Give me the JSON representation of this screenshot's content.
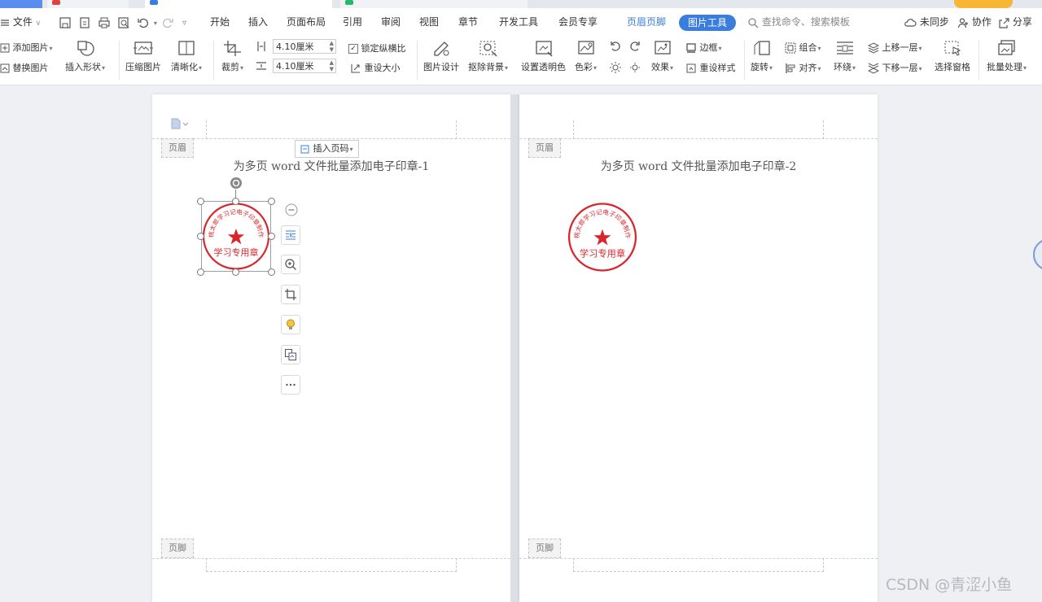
{
  "window": {
    "doc_tabs": [
      "",
      "",
      "",
      ""
    ]
  },
  "menubar": {
    "file_label": "文件",
    "tabs": [
      "开始",
      "插入",
      "页面布局",
      "引用",
      "审阅",
      "视图",
      "章节",
      "开发工具",
      "会员专享",
      "页眉页脚",
      "图片工具"
    ],
    "active_tab": "图片工具",
    "search_placeholder": "查找命令、搜索模板",
    "sync_label": "未同步",
    "collab_label": "协作",
    "share_label": "分享"
  },
  "ribbon": {
    "add_picture": "添加图片",
    "replace_picture": "替换图片",
    "insert_shape": "插入形状",
    "compress_picture": "压缩图片",
    "sharpen": "清晰化",
    "crop": "裁剪",
    "width_value": "4.10厘米",
    "height_value": "4.10厘米",
    "lock_ratio": "锁定纵横比",
    "reset_size": "重设大小",
    "picture_design": "图片设计",
    "remove_background": "抠除背景",
    "set_transparent": "设置透明色",
    "color": "色彩",
    "effects": "效果",
    "border": "边框",
    "reset_style": "重设样式",
    "rotate": "旋转",
    "group": "组合",
    "align": "对齐",
    "wrap": "环绕",
    "bring_forward": "上移一层",
    "send_backward": "下移一层",
    "selection_pane": "选择窗格",
    "batch_process": "批量处理"
  },
  "pages": [
    {
      "header_tag": "页眉",
      "footer_tag": "页脚",
      "title": "为多页 word 文件批量添加电子印章-1",
      "insert_page_number": "插入页码",
      "seal": {
        "arc_text": "桃太郎学习记电子印章制作",
        "center_text": "学习专用章"
      }
    },
    {
      "header_tag": "页眉",
      "footer_tag": "页脚",
      "title": "为多页 word 文件批量添加电子印章-2",
      "seal": {
        "arc_text": "桃太郎学习记电子印章制作",
        "center_text": "学习专用章"
      }
    }
  ],
  "watermark": "CSDN @青涩小鱼",
  "colors": {
    "accent": "#3b7ddd",
    "seal_red": "#d9262c",
    "canvas": "#eef0f4"
  },
  "icons": [
    "doc-icon",
    "save-icon",
    "print-icon",
    "preview-icon",
    "undo-icon",
    "redo-icon",
    "search-icon",
    "cloud-icon",
    "collab-icon",
    "share-icon",
    "seal-icon",
    "rotate-handle-icon",
    "minus-icon",
    "layout-options-icon",
    "zoom-icon",
    "crop-icon",
    "bulb-icon",
    "convert-icon",
    "more-icon"
  ]
}
